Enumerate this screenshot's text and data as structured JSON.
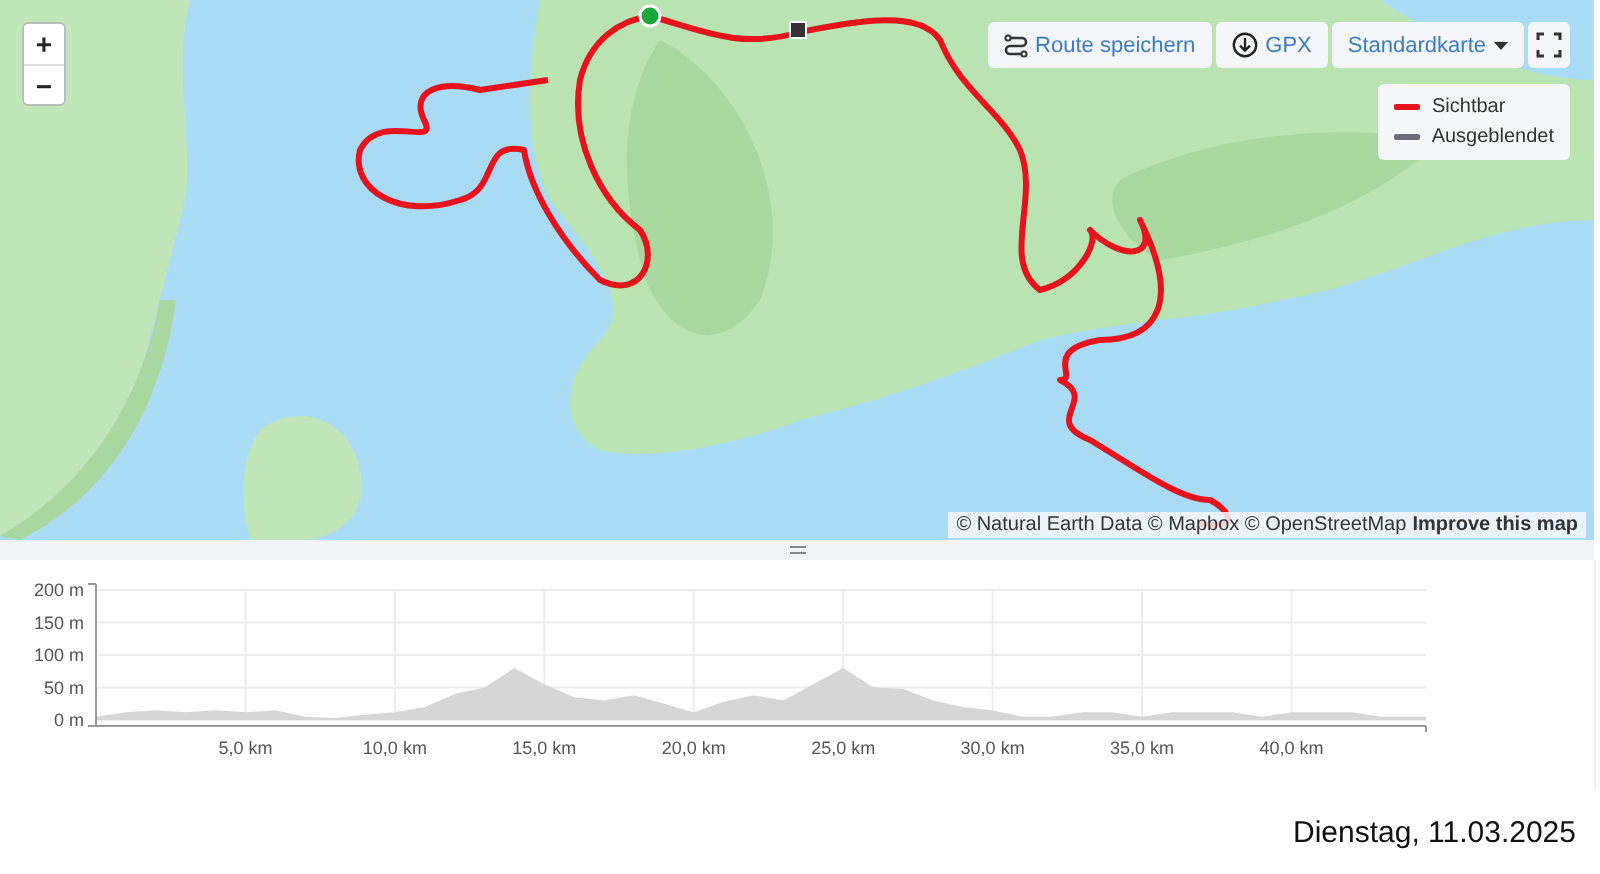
{
  "map": {
    "kind": "picture",
    "zoom_controls": [
      "+",
      "−"
    ],
    "toolbar": [
      {
        "kind": "route",
        "label": "Route speichern"
      },
      {
        "kind": "download",
        "label": "GPX"
      },
      {
        "kind": "dropdown",
        "label": "Standardkarte"
      },
      {
        "kind": "fullscreen"
      }
    ],
    "legend": [
      {
        "label": "Sichtbar",
        "color": "#e8121c"
      },
      {
        "label": "Ausgeblendet",
        "color": "#6b6e78"
      }
    ],
    "attribution": "© Natural Earth Data © Mapbox © OpenStreetMap",
    "attribution_link": "Improve this map"
  },
  "elevation": {
    "chart_data": {
      "type": "area",
      "x": [
        0,
        1,
        2,
        3,
        4,
        5,
        6,
        7,
        8,
        9,
        10,
        11,
        12,
        13,
        14,
        15,
        16,
        17,
        18,
        19,
        20,
        21,
        22,
        23,
        24,
        25,
        26,
        27,
        28,
        29,
        30,
        31,
        32,
        33,
        34,
        35,
        36,
        37,
        38,
        39,
        40,
        41,
        42,
        43,
        44,
        44.5
      ],
      "grid": true,
      "series": [
        {
          "color": "#d6d6d6",
          "values": [
            5,
            12,
            15,
            12,
            15,
            12,
            15,
            5,
            3,
            8,
            12,
            20,
            40,
            50,
            80,
            55,
            35,
            30,
            38,
            25,
            12,
            28,
            38,
            30,
            55,
            80,
            50,
            48,
            30,
            20,
            15,
            5,
            5,
            12,
            12,
            5,
            12,
            12,
            12,
            5,
            12,
            12,
            12,
            5,
            5,
            5
          ]
        }
      ],
      "xlim": [
        0,
        44.5
      ],
      "ylim": [
        0,
        200
      ],
      "xticks": [
        {
          "value": 5,
          "label": "5,0 km"
        },
        {
          "value": 10,
          "label": "10,0 km"
        },
        {
          "value": 15,
          "label": "15,0 km"
        },
        {
          "value": 20,
          "label": "20,0 km"
        },
        {
          "value": 25,
          "label": "25,0 km"
        },
        {
          "value": 30,
          "label": "30,0 km"
        },
        {
          "value": 35,
          "label": "35,0 km"
        },
        {
          "value": 40,
          "label": "40,0 km"
        }
      ],
      "yticks": [
        {
          "value": 0,
          "label": "0 m"
        },
        {
          "value": 50,
          "label": "50 m"
        },
        {
          "value": 100,
          "label": "100 m"
        },
        {
          "value": 150,
          "label": "150 m"
        },
        {
          "value": 200,
          "label": "200 m"
        }
      ]
    }
  },
  "date": "Dienstag, 11.03.2025"
}
